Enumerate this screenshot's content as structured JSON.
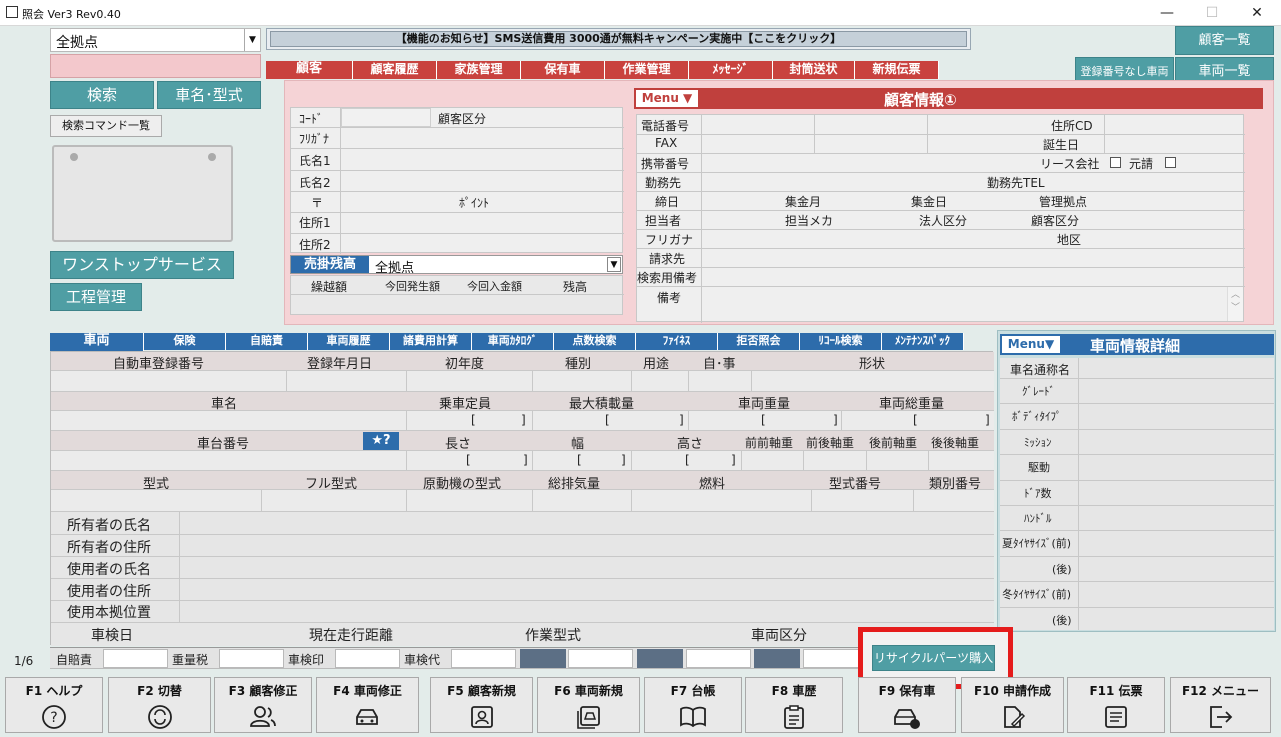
{
  "window": {
    "title": "照会 Ver3 Rev0.40",
    "min": "—",
    "max": "☐",
    "close": "✕"
  },
  "top": {
    "branch_select": "全拠点",
    "notice": "【機能のお知らせ】SMS送信費用 3000通が無料キャンペーン実施中【ここをクリック】",
    "search_btn": "検索",
    "carname_btn": "車名･型式",
    "search_cmd_btn": "検索コマンド一覧",
    "onestop_btn": "ワンストップサービス",
    "process_btn": "工程管理",
    "customer_list_btn": "顧客一覧",
    "no_reg_btn": "登録番号なし車両",
    "vehicle_list_btn": "車両一覧"
  },
  "customer_tabs": [
    "顧客",
    "顧客履歴",
    "家族管理",
    "保有車",
    "作業管理",
    "ﾒｯｾｰｼﾞ",
    "封筒送状",
    "新規伝票"
  ],
  "customer_left": {
    "code": "ｺｰﾄﾞ",
    "cust_type": "顧客区分",
    "furigana": "ﾌﾘｶﾞﾅ",
    "name1": "氏名1",
    "name2": "氏名2",
    "zip": "〒",
    "point": "ﾎﾟｲﾝﾄ",
    "addr1": "住所1",
    "addr2": "住所2",
    "receivable": "売掛残高",
    "receivable_branch": "全拠点",
    "carry": "繰越額",
    "this_issue": "今回発生額",
    "this_receipt": "今回入金額",
    "balance": "残高"
  },
  "customer_info": {
    "menu": "Menu ▼",
    "title": "顧客情報①",
    "phone": "電話番号",
    "addr_cd": "住所CD",
    "fax": "FAX",
    "birthday": "誕生日",
    "mobile": "携帯番号",
    "lease": "リース会社",
    "original": "元請",
    "workplace": "勤務先",
    "workplace_tel": "勤務先TEL",
    "closing": "締日",
    "collect_month": "集金月",
    "collect_day": "集金日",
    "mgmt_base": "管理拠点",
    "staff": "担当者",
    "staff_maker": "担当メカ",
    "corp_type": "法人区分",
    "cust_type": "顧客区分",
    "furigana": "フリガナ",
    "region": "地区",
    "billing": "請求先",
    "search_note": "検索用備考",
    "remarks": "備考"
  },
  "vehicle_tabs": [
    "車両",
    "保険",
    "自賠責",
    "車両履歴",
    "諸費用計算",
    "車両ｶﾀﾛｸﾞ",
    "点数検索",
    "ﾌｧｲﾈｽ",
    "拒否照会",
    "ﾘｺｰﾙ検索",
    "ﾒﾝﾃﾅﾝｽﾊﾟｯｸ"
  ],
  "vehicle": {
    "reg_no": "自動車登録番号",
    "reg_date": "登録年月日",
    "first_year": "初年度",
    "kind": "種別",
    "use": "用途",
    "self_biz": "自･事",
    "shape": "形状",
    "car_name": "車名",
    "capacity": "乗車定員",
    "max_load": "最大積載量",
    "weight": "車両重量",
    "gross_weight": "車両総重量",
    "chassis_no": "車台番号",
    "star_btn": "★?",
    "length": "長さ",
    "width": "幅",
    "height": "高さ",
    "ff_axle": "前前軸重",
    "fr_axle": "前後軸重",
    "rf_axle": "後前軸重",
    "rr_axle": "後後軸重",
    "model": "型式",
    "full_model": "フル型式",
    "engine_model": "原動機の型式",
    "displacement": "総排気量",
    "fuel": "燃料",
    "model_no": "型式番号",
    "class_no": "類別番号",
    "owner_name": "所有者の氏名",
    "owner_addr": "所有者の住所",
    "user_name": "使用者の氏名",
    "user_addr": "使用者の住所",
    "base_location": "使用本拠位置",
    "inspection": "車検日",
    "mileage": "現在走行距離",
    "work_model": "作業型式",
    "vehicle_type": "車両区分",
    "bracket_open": "[",
    "bracket_close": "]"
  },
  "vehicle_detail": {
    "menu": "Menu▼",
    "title": "車両情報詳細",
    "rows": [
      "車名通称名",
      "ｸﾞﾚｰﾄﾞ",
      "ﾎﾞﾃﾞｨﾀｲﾌﾟ",
      "ﾐｯｼｮﾝ",
      "駆動",
      "ﾄﾞｱ数",
      "ﾊﾝﾄﾞﾙ",
      "夏ﾀｲﾔｻｲｽﾞ(前)",
      "(後)",
      "冬ﾀｲﾔｻｲｽﾞ(前)",
      "(後)"
    ]
  },
  "status": {
    "page": "1/6",
    "jibaiseki": "自賠責",
    "weight_tax": "重量税",
    "inspection_stamp": "車検印",
    "inspection_fee": "車検代",
    "recycle_btn": "リサイクルパーツ購入"
  },
  "fkeys": [
    {
      "label": "F1 ヘルプ",
      "icon": "help-icon"
    },
    {
      "label": "F2 切替",
      "icon": "switch-icon"
    },
    {
      "label": "F3 顧客修正",
      "icon": "users-icon"
    },
    {
      "label": "F4 車両修正",
      "icon": "car-edit-icon"
    },
    {
      "label": "F5 顧客新規",
      "icon": "contact-card-icon"
    },
    {
      "label": "F6 車両新規",
      "icon": "car-new-icon"
    },
    {
      "label": "F7 台帳",
      "icon": "book-icon"
    },
    {
      "label": "F8 車歴",
      "icon": "clipboard-icon"
    },
    {
      "label": "F9 保有車",
      "icon": "car-lock-icon"
    },
    {
      "label": "F10 申請作成",
      "icon": "document-edit-icon"
    },
    {
      "label": "F11 伝票",
      "icon": "list-icon"
    },
    {
      "label": "F12 メニュー",
      "icon": "exit-icon"
    }
  ],
  "colors": {
    "accent_teal": "#4f9ea4",
    "customer_red": "#c9423e",
    "vehicle_blue": "#2d6cab",
    "highlight": "#e51c1c"
  }
}
